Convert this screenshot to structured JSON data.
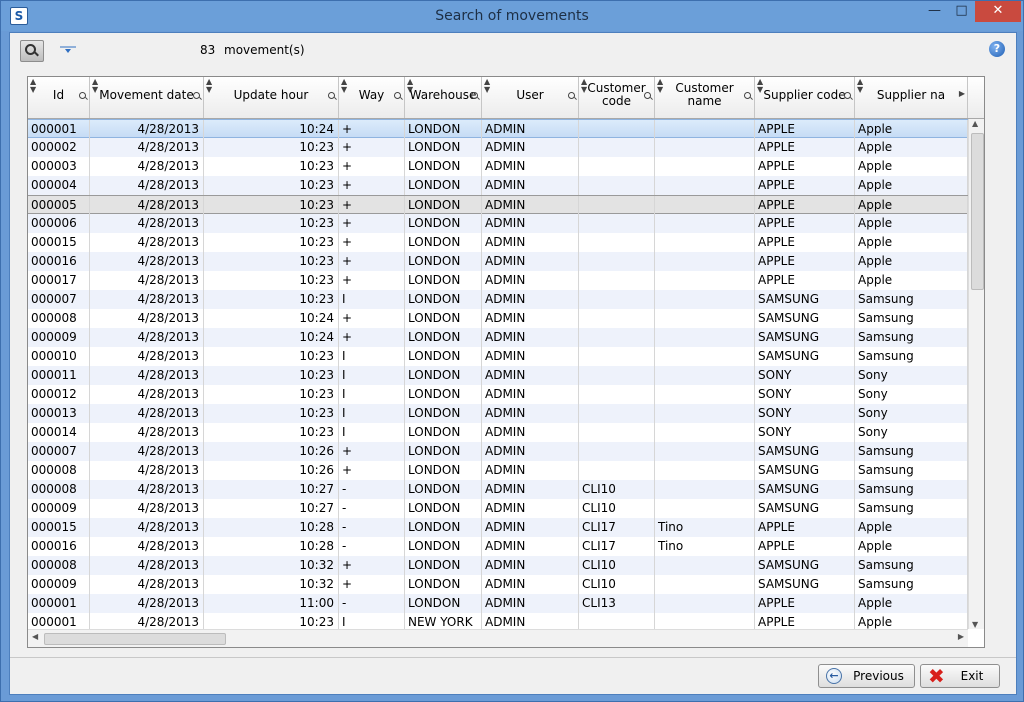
{
  "window": {
    "title": "Search of movements",
    "app_icon": "S"
  },
  "toolbar": {
    "count": "83",
    "count_label": "movement(s)",
    "help": "?"
  },
  "columns": [
    {
      "label": "Id"
    },
    {
      "label": "Movement date"
    },
    {
      "label": "Update hour"
    },
    {
      "label": "Way"
    },
    {
      "label": "Warehouse"
    },
    {
      "label": "User"
    },
    {
      "label": "Customer\ncode"
    },
    {
      "label": "Customer\nname"
    },
    {
      "label": "Supplier code"
    },
    {
      "label": "Supplier na"
    }
  ],
  "rows": [
    [
      "000001",
      "4/28/2013",
      "10:24",
      "+",
      "LONDON",
      "ADMIN",
      "",
      "",
      "APPLE",
      "Apple"
    ],
    [
      "000002",
      "4/28/2013",
      "10:23",
      "+",
      "LONDON",
      "ADMIN",
      "",
      "",
      "APPLE",
      "Apple"
    ],
    [
      "000003",
      "4/28/2013",
      "10:23",
      "+",
      "LONDON",
      "ADMIN",
      "",
      "",
      "APPLE",
      "Apple"
    ],
    [
      "000004",
      "4/28/2013",
      "10:23",
      "+",
      "LONDON",
      "ADMIN",
      "",
      "",
      "APPLE",
      "Apple"
    ],
    [
      "000005",
      "4/28/2013",
      "10:23",
      "+",
      "LONDON",
      "ADMIN",
      "",
      "",
      "APPLE",
      "Apple"
    ],
    [
      "000006",
      "4/28/2013",
      "10:23",
      "+",
      "LONDON",
      "ADMIN",
      "",
      "",
      "APPLE",
      "Apple"
    ],
    [
      "000015",
      "4/28/2013",
      "10:23",
      "+",
      "LONDON",
      "ADMIN",
      "",
      "",
      "APPLE",
      "Apple"
    ],
    [
      "000016",
      "4/28/2013",
      "10:23",
      "+",
      "LONDON",
      "ADMIN",
      "",
      "",
      "APPLE",
      "Apple"
    ],
    [
      "000017",
      "4/28/2013",
      "10:23",
      "+",
      "LONDON",
      "ADMIN",
      "",
      "",
      "APPLE",
      "Apple"
    ],
    [
      "000007",
      "4/28/2013",
      "10:23",
      "I",
      "LONDON",
      "ADMIN",
      "",
      "",
      "SAMSUNG",
      "Samsung"
    ],
    [
      "000008",
      "4/28/2013",
      "10:24",
      "+",
      "LONDON",
      "ADMIN",
      "",
      "",
      "SAMSUNG",
      "Samsung"
    ],
    [
      "000009",
      "4/28/2013",
      "10:24",
      "+",
      "LONDON",
      "ADMIN",
      "",
      "",
      "SAMSUNG",
      "Samsung"
    ],
    [
      "000010",
      "4/28/2013",
      "10:23",
      "I",
      "LONDON",
      "ADMIN",
      "",
      "",
      "SAMSUNG",
      "Samsung"
    ],
    [
      "000011",
      "4/28/2013",
      "10:23",
      "I",
      "LONDON",
      "ADMIN",
      "",
      "",
      "SONY",
      "Sony"
    ],
    [
      "000012",
      "4/28/2013",
      "10:23",
      "I",
      "LONDON",
      "ADMIN",
      "",
      "",
      "SONY",
      "Sony"
    ],
    [
      "000013",
      "4/28/2013",
      "10:23",
      "I",
      "LONDON",
      "ADMIN",
      "",
      "",
      "SONY",
      "Sony"
    ],
    [
      "000014",
      "4/28/2013",
      "10:23",
      "I",
      "LONDON",
      "ADMIN",
      "",
      "",
      "SONY",
      "Sony"
    ],
    [
      "000007",
      "4/28/2013",
      "10:26",
      "+",
      "LONDON",
      "ADMIN",
      "",
      "",
      "SAMSUNG",
      "Samsung"
    ],
    [
      "000008",
      "4/28/2013",
      "10:26",
      "+",
      "LONDON",
      "ADMIN",
      "",
      "",
      "SAMSUNG",
      "Samsung"
    ],
    [
      "000008",
      "4/28/2013",
      "10:27",
      "-",
      "LONDON",
      "ADMIN",
      "CLI10",
      "",
      "SAMSUNG",
      "Samsung"
    ],
    [
      "000009",
      "4/28/2013",
      "10:27",
      "-",
      "LONDON",
      "ADMIN",
      "CLI10",
      "",
      "SAMSUNG",
      "Samsung"
    ],
    [
      "000015",
      "4/28/2013",
      "10:28",
      "-",
      "LONDON",
      "ADMIN",
      "CLI17",
      "Tino",
      "APPLE",
      "Apple"
    ],
    [
      "000016",
      "4/28/2013",
      "10:28",
      "-",
      "LONDON",
      "ADMIN",
      "CLI17",
      "Tino",
      "APPLE",
      "Apple"
    ],
    [
      "000008",
      "4/28/2013",
      "10:32",
      "+",
      "LONDON",
      "ADMIN",
      "CLI10",
      "",
      "SAMSUNG",
      "Samsung"
    ],
    [
      "000009",
      "4/28/2013",
      "10:32",
      "+",
      "LONDON",
      "ADMIN",
      "CLI10",
      "",
      "SAMSUNG",
      "Samsung"
    ],
    [
      "000001",
      "4/28/2013",
      "11:00",
      "-",
      "LONDON",
      "ADMIN",
      "CLI13",
      "",
      "APPLE",
      "Apple"
    ],
    [
      "000001",
      "4/28/2013",
      "10:23",
      "I",
      "NEW YORK",
      "ADMIN",
      "",
      "",
      "APPLE",
      "Apple"
    ]
  ],
  "selected_row": 0,
  "current_row": 4,
  "buttons": {
    "previous": "Previous",
    "exit": "Exit"
  },
  "colors": {
    "title_bar": "#6b9fd9",
    "close": "#c94a3f",
    "selection": "#c6dcf5",
    "alt_row": "#eef2fb"
  }
}
